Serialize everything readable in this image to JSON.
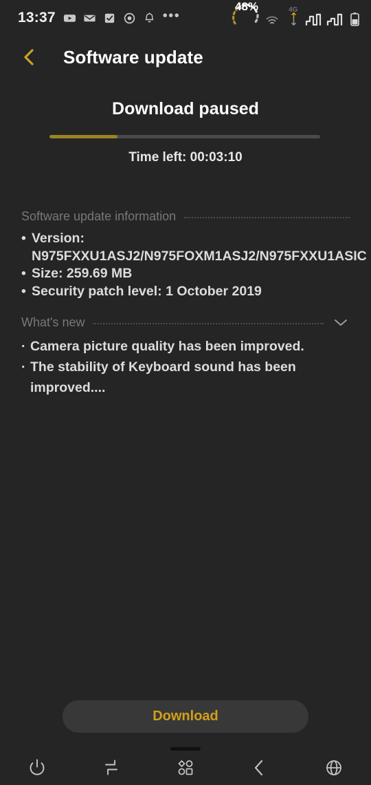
{
  "statusbar": {
    "time": "13:37",
    "icons": [
      "youtube-icon",
      "mail-icon",
      "checkbox-icon",
      "circle-dot-icon",
      "bell-icon"
    ],
    "overflow": "•••",
    "battery_percent": "48%",
    "battery_level": 48,
    "network_label": "4G",
    "wifi": "wifi-icon",
    "signal_bars": 2,
    "battery_icon": "battery-icon"
  },
  "header": {
    "back": "back-arrow",
    "title": "Software update"
  },
  "progress": {
    "status": "Download paused",
    "percent": 25,
    "time_left": "Time left: 00:03:10"
  },
  "info_section": {
    "title": "Software update information",
    "items": [
      "Version: N975FXXU1ASJ2/N975FOXM1ASJ2/N975FXXU1ASIC",
      "Size: 259.69 MB",
      "Security patch level: 1 October 2019"
    ]
  },
  "whats_new": {
    "title": "What's new",
    "expand_icon": "chevron-down-icon",
    "items": [
      "Camera picture quality has been improved.",
      "The stability of Keyboard sound has been improved...."
    ]
  },
  "actions": {
    "download_label": "Download"
  },
  "navbar": {
    "items": [
      {
        "name": "power-icon"
      },
      {
        "name": "switch-icon"
      },
      {
        "name": "apps-grid-icon"
      },
      {
        "name": "back-chevron-icon"
      },
      {
        "name": "globe-icon"
      }
    ]
  },
  "colors": {
    "background": "#252525",
    "accent_gold": "#d4a017",
    "progress_fill": "#9c8422",
    "muted_text": "#787878",
    "body_text": "#dcdcdc"
  }
}
